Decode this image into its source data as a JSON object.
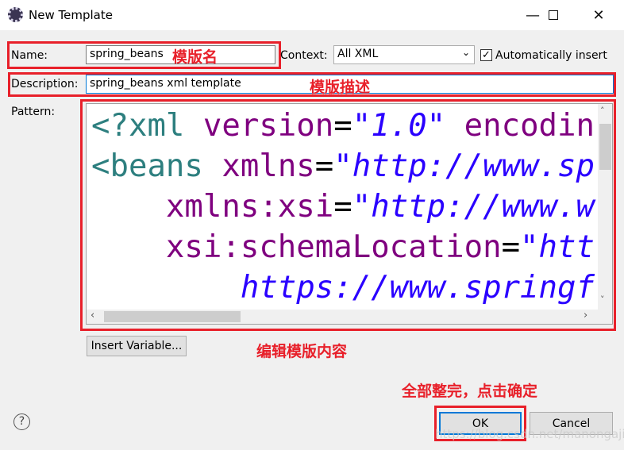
{
  "window": {
    "title": "New Template",
    "minimize_icon": "minimize-icon",
    "maximize_icon": "maximize-icon",
    "close_icon": "close-icon"
  },
  "form": {
    "name_label": "Name:",
    "name_value": "spring_beans",
    "context_label": "Context:",
    "context_value": "All XML",
    "auto_insert_label": "Automatically insert",
    "auto_insert_checked": true,
    "description_label": "Description:",
    "description_value": "spring_beans xml template",
    "pattern_label": "Pattern:"
  },
  "pattern_lines": [
    [
      {
        "t": "<?xml ",
        "c": "tag"
      },
      {
        "t": "version",
        "c": "attr"
      },
      {
        "t": "=",
        "c": "eq"
      },
      {
        "t": "\"1.0\"",
        "c": "str"
      },
      {
        "t": " encodin",
        "c": "attr"
      }
    ],
    [
      {
        "t": "<beans ",
        "c": "tag"
      },
      {
        "t": "xmlns",
        "c": "attr"
      },
      {
        "t": "=",
        "c": "eq"
      },
      {
        "t": "\"http://www.sp",
        "c": "str"
      }
    ],
    [
      {
        "t": "    xmlns:xsi",
        "c": "attr"
      },
      {
        "t": "=",
        "c": "eq"
      },
      {
        "t": "\"http://www.w",
        "c": "str"
      }
    ],
    [
      {
        "t": "    xsi:schemaLocation",
        "c": "attr"
      },
      {
        "t": "=",
        "c": "eq"
      },
      {
        "t": "\"htt",
        "c": "str"
      }
    ],
    [
      {
        "t": "        https://www.springf",
        "c": "str"
      }
    ]
  ],
  "buttons": {
    "insert_variable": "Insert Variable...",
    "ok": "OK",
    "cancel": "Cancel",
    "help": "?"
  },
  "annotations": {
    "name": "模版名",
    "description": "模版描述",
    "pattern": "编辑模版内容",
    "finish": "全部整完，点击确定"
  },
  "watermark": "https://blog.csdn.net/manongajie",
  "colors": {
    "annotation": "#e8202a",
    "tag": "#2d7f7f",
    "attribute": "#7f007f",
    "string": "#2a00ff"
  }
}
